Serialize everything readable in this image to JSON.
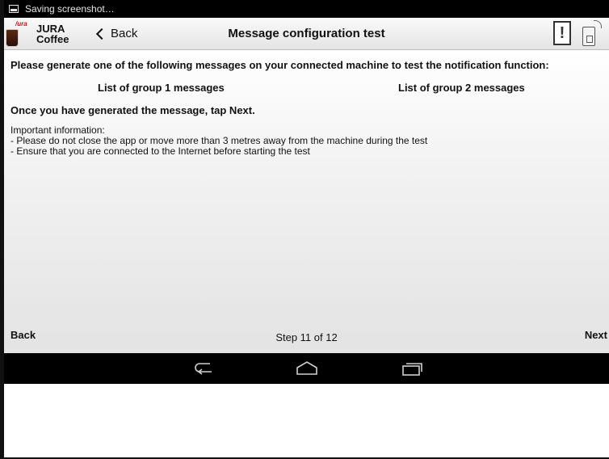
{
  "status_bar": {
    "text": "Saving screenshot…",
    "icon": "screenshot-icon"
  },
  "app_bar": {
    "app_name_line1": "JURA",
    "app_name_line2": "Coffee",
    "back_label": "Back",
    "title": "Message configuration test",
    "warning_label": "!",
    "icons": [
      "warning-icon",
      "coffee-machine-wifi-icon"
    ]
  },
  "content": {
    "instruction": "Please generate one of the following messages on your connected machine to test the notification function:",
    "group1_link": "List of group 1 messages",
    "group2_link": "List of group 2 messages",
    "generated_note": "Once you have generated the message, tap Next.",
    "info_title": "Important information:",
    "info_line1": "- Please do not close the app or move more than 3 metres away from the machine during the test",
    "info_line2": "- Ensure that you are connected to the Internet before starting the test"
  },
  "footer": {
    "back_label": "Back",
    "step_text": "Step 11 of 12",
    "next_label": "Next"
  },
  "nav_bar": {
    "icons": [
      "back-nav-icon",
      "home-nav-icon",
      "recent-apps-icon"
    ]
  },
  "colors": {
    "status_bar": "#000000",
    "nav_bar": "#000000",
    "brand_red": "#c0141b"
  }
}
